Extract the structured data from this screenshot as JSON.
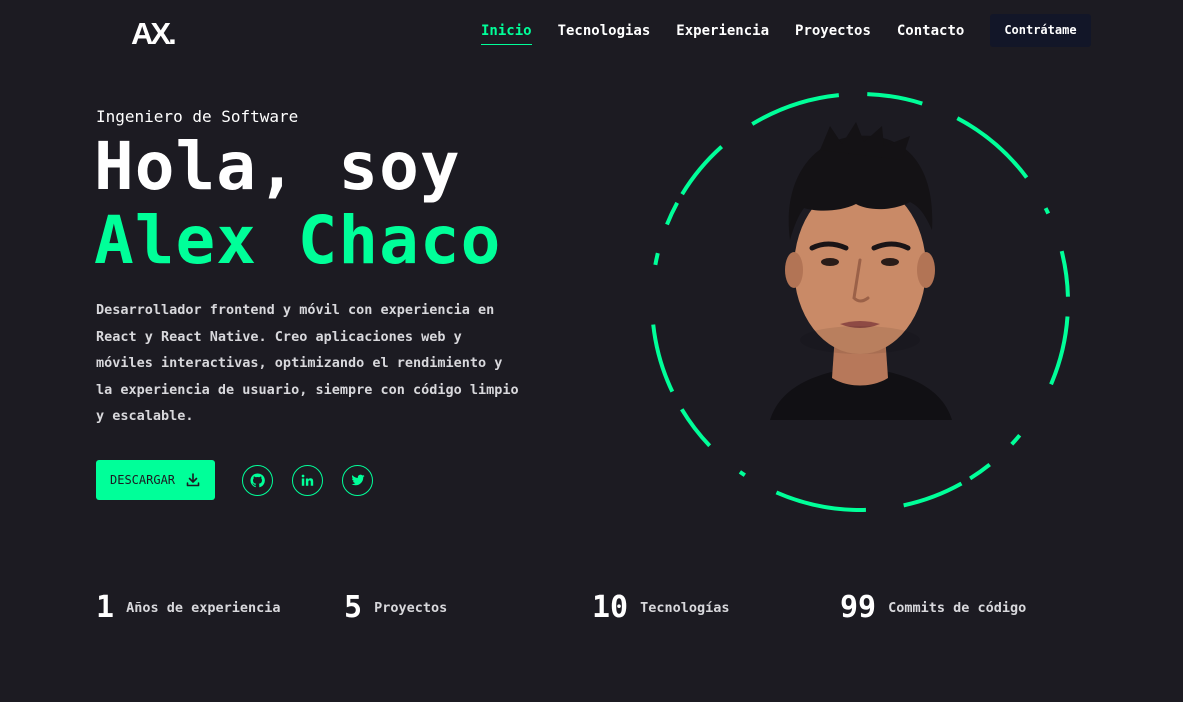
{
  "logo": {
    "text": "AX."
  },
  "nav": {
    "items": [
      {
        "label": "Inicio",
        "active": true
      },
      {
        "label": "Tecnologias",
        "active": false
      },
      {
        "label": "Experiencia",
        "active": false
      },
      {
        "label": "Proyectos",
        "active": false
      },
      {
        "label": "Contacto",
        "active": false
      }
    ],
    "hire_label": "Contrátame"
  },
  "hero": {
    "role": "Ingeniero de Software",
    "greeting": "Hola, soy",
    "name": "Alex Chaco",
    "description": "Desarrollador frontend y móvil con experiencia en React y React Native. Creo aplicaciones web y móviles interactivas, optimizando el rendimiento y la experiencia de usuario, siempre con código limpio y escalable.",
    "download_label": "DESCARGAR",
    "socials": [
      {
        "icon": "github-icon"
      },
      {
        "icon": "linkedin-icon"
      },
      {
        "icon": "twitter-icon"
      }
    ]
  },
  "stats": [
    {
      "value": "1",
      "label": "Años de experiencia"
    },
    {
      "value": "5",
      "label": "Proyectos"
    },
    {
      "value": "10",
      "label": "Tecnologías"
    },
    {
      "value": "99",
      "label": "Commits de código"
    }
  ],
  "colors": {
    "background": "#1c1b22",
    "accent": "#00ff99",
    "button_dark": "#121628"
  }
}
